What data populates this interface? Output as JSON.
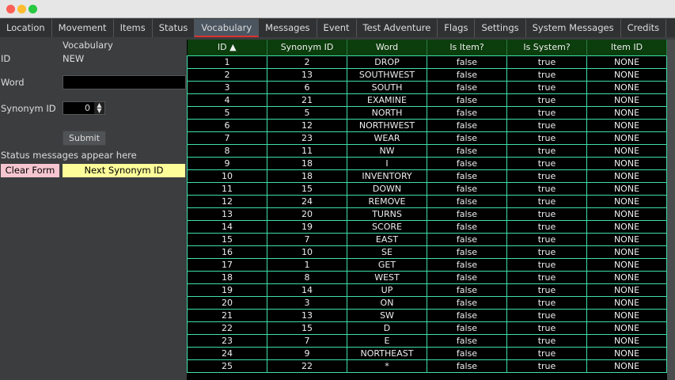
{
  "window": {
    "controls": {
      "close": "#fe5f57",
      "minimize": "#febc2e",
      "zoom": "#28c840"
    }
  },
  "tabs": [
    "Location",
    "Movement",
    "Items",
    "Status",
    "Vocabulary",
    "Messages",
    "Event",
    "Test Adventure",
    "Flags",
    "Settings",
    "System Messages",
    "Credits"
  ],
  "active_tab": "Vocabulary",
  "form": {
    "title": "Vocabulary",
    "id_label": "ID",
    "id_value": "NEW",
    "word_label": "Word",
    "word_value": "",
    "synonym_label": "Synonym ID",
    "synonym_value": "0",
    "submit": "Submit",
    "status": "Status messages appear here",
    "clear": "Clear Form",
    "next": "Next Synonym ID"
  },
  "table": {
    "columns": [
      "ID ▲",
      "Synonym ID",
      "Word",
      "Is Item?",
      "Is System?",
      "Item ID"
    ],
    "rows": [
      [
        "1",
        "2",
        "DROP",
        "false",
        "true",
        "NONE"
      ],
      [
        "2",
        "13",
        "SOUTHWEST",
        "false",
        "true",
        "NONE"
      ],
      [
        "3",
        "6",
        "SOUTH",
        "false",
        "true",
        "NONE"
      ],
      [
        "4",
        "21",
        "EXAMINE",
        "false",
        "true",
        "NONE"
      ],
      [
        "5",
        "5",
        "NORTH",
        "false",
        "true",
        "NONE"
      ],
      [
        "6",
        "12",
        "NORTHWEST",
        "false",
        "true",
        "NONE"
      ],
      [
        "7",
        "23",
        "WEAR",
        "false",
        "true",
        "NONE"
      ],
      [
        "8",
        "11",
        "NW",
        "false",
        "true",
        "NONE"
      ],
      [
        "9",
        "18",
        "I",
        "false",
        "true",
        "NONE"
      ],
      [
        "10",
        "18",
        "INVENTORY",
        "false",
        "true",
        "NONE"
      ],
      [
        "11",
        "15",
        "DOWN",
        "false",
        "true",
        "NONE"
      ],
      [
        "12",
        "24",
        "REMOVE",
        "false",
        "true",
        "NONE"
      ],
      [
        "13",
        "20",
        "TURNS",
        "false",
        "true",
        "NONE"
      ],
      [
        "14",
        "19",
        "SCORE",
        "false",
        "true",
        "NONE"
      ],
      [
        "15",
        "7",
        "EAST",
        "false",
        "true",
        "NONE"
      ],
      [
        "16",
        "10",
        "SE",
        "false",
        "true",
        "NONE"
      ],
      [
        "17",
        "1",
        "GET",
        "false",
        "true",
        "NONE"
      ],
      [
        "18",
        "8",
        "WEST",
        "false",
        "true",
        "NONE"
      ],
      [
        "19",
        "14",
        "UP",
        "false",
        "true",
        "NONE"
      ],
      [
        "20",
        "3",
        "ON",
        "false",
        "true",
        "NONE"
      ],
      [
        "21",
        "13",
        "SW",
        "false",
        "true",
        "NONE"
      ],
      [
        "22",
        "15",
        "D",
        "false",
        "true",
        "NONE"
      ],
      [
        "23",
        "7",
        "E",
        "false",
        "true",
        "NONE"
      ],
      [
        "24",
        "9",
        "NORTHEAST",
        "false",
        "true",
        "NONE"
      ],
      [
        "25",
        "22",
        "*",
        "false",
        "true",
        "NONE"
      ]
    ]
  }
}
